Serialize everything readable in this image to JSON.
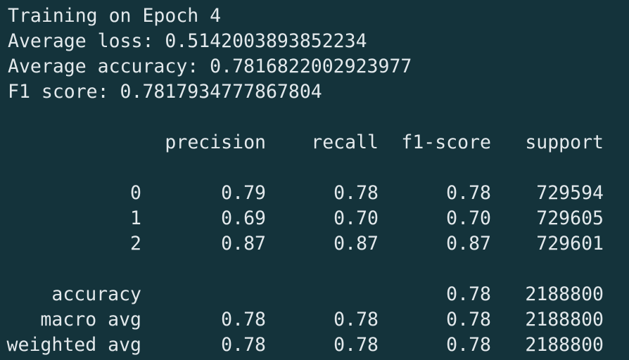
{
  "header": {
    "epoch_line": "Training on Epoch 4",
    "loss_line": "Average loss: 0.5142003893852234",
    "accuracy_line": "Average accuracy: 0.7816822002923977",
    "f1_line": "F1 score: 0.7817934777867804"
  },
  "report": {
    "columns": [
      "precision",
      "recall",
      "f1-score",
      "support"
    ],
    "class_rows": [
      {
        "label": "0",
        "precision": "0.79",
        "recall": "0.78",
        "f1": "0.78",
        "support": "729594"
      },
      {
        "label": "1",
        "precision": "0.69",
        "recall": "0.70",
        "f1": "0.70",
        "support": "729605"
      },
      {
        "label": "2",
        "precision": "0.87",
        "recall": "0.87",
        "f1": "0.87",
        "support": "729601"
      }
    ],
    "accuracy_row": {
      "label": "accuracy",
      "f1": "0.78",
      "support": "2188800"
    },
    "macro_row": {
      "label": "macro avg",
      "precision": "0.78",
      "recall": "0.78",
      "f1": "0.78",
      "support": "2188800"
    },
    "weighted_row": {
      "label": "weighted avg",
      "precision": "0.78",
      "recall": "0.78",
      "f1": "0.78",
      "support": "2188800"
    }
  }
}
